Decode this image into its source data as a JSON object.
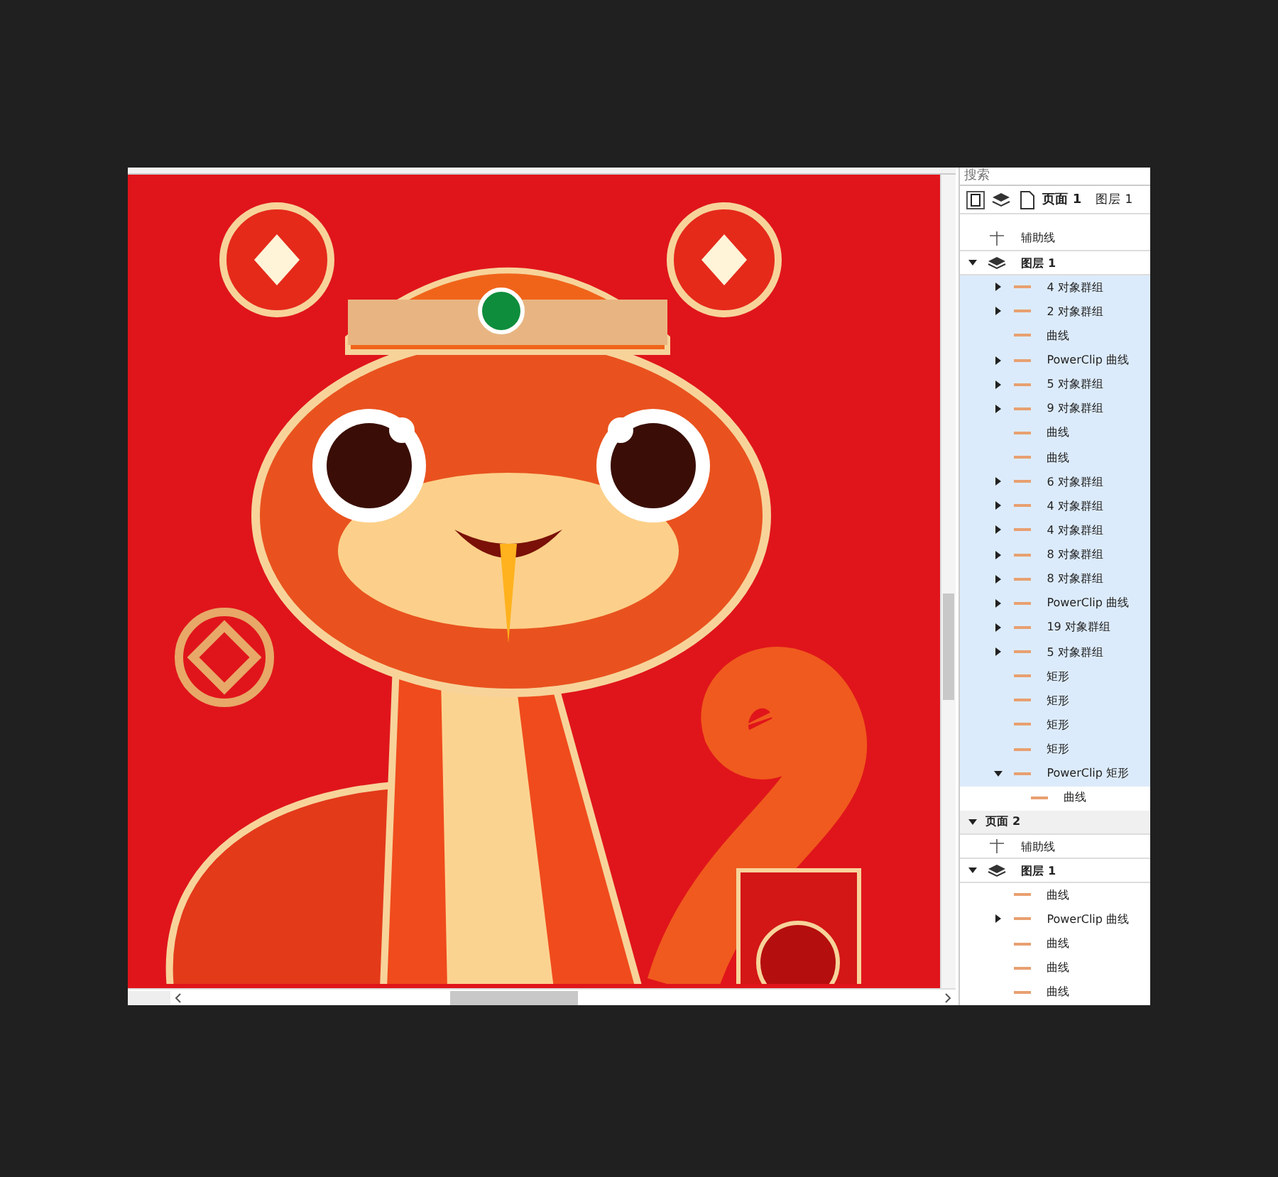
{
  "objects_panel": {
    "search": {
      "placeholder": "搜索"
    },
    "header": {
      "page": "页面 1",
      "layer": "图层 1"
    },
    "tree": [
      {
        "kind": "guides",
        "label": "辅助线"
      },
      {
        "kind": "layer",
        "label": "图层 1",
        "expanded": true,
        "children": [
          {
            "kind": "object",
            "label": "4 对象群组",
            "expanded": false,
            "selected": true
          },
          {
            "kind": "object",
            "label": "2 对象群组",
            "expanded": false,
            "selected": true
          },
          {
            "kind": "object",
            "label": "曲线",
            "selected": true
          },
          {
            "kind": "object",
            "label": "PowerClip 曲线",
            "expanded": false,
            "selected": true
          },
          {
            "kind": "object",
            "label": "5 对象群组",
            "expanded": false,
            "selected": true
          },
          {
            "kind": "object",
            "label": "9 对象群组",
            "expanded": false,
            "selected": true
          },
          {
            "kind": "object",
            "label": "曲线",
            "selected": true
          },
          {
            "kind": "object",
            "label": "曲线",
            "selected": true
          },
          {
            "kind": "object",
            "label": "6 对象群组",
            "expanded": false,
            "selected": true
          },
          {
            "kind": "object",
            "label": "4 对象群组",
            "expanded": false,
            "selected": true
          },
          {
            "kind": "object",
            "label": "4 对象群组",
            "expanded": false,
            "selected": true
          },
          {
            "kind": "object",
            "label": "8 对象群组",
            "expanded": false,
            "selected": true
          },
          {
            "kind": "object",
            "label": "8 对象群组",
            "expanded": false,
            "selected": true
          },
          {
            "kind": "object",
            "label": "PowerClip 曲线",
            "expanded": false,
            "selected": true
          },
          {
            "kind": "object",
            "label": "19 对象群组",
            "expanded": false,
            "selected": true
          },
          {
            "kind": "object",
            "label": "5 对象群组",
            "expanded": false,
            "selected": true
          },
          {
            "kind": "object",
            "label": "矩形",
            "selected": true
          },
          {
            "kind": "object",
            "label": "矩形",
            "selected": true
          },
          {
            "kind": "object",
            "label": "矩形",
            "selected": true
          },
          {
            "kind": "object",
            "label": "矩形",
            "selected": true
          },
          {
            "kind": "object",
            "label": "PowerClip 矩形",
            "expanded": true,
            "selected": true,
            "children": [
              {
                "kind": "object",
                "label": "曲线",
                "selected": false
              }
            ]
          }
        ]
      },
      {
        "kind": "page",
        "label": "页面 2",
        "expanded": true,
        "children": [
          {
            "kind": "guides",
            "label": "辅助线"
          },
          {
            "kind": "layer",
            "label": "图层 1",
            "expanded": true,
            "children": [
              {
                "kind": "object",
                "label": "曲线",
                "selected": false
              },
              {
                "kind": "object",
                "label": "PowerClip 曲线",
                "expanded": false,
                "selected": false
              },
              {
                "kind": "object",
                "label": "曲线",
                "selected": false
              },
              {
                "kind": "object",
                "label": "曲线",
                "selected": false
              },
              {
                "kind": "object",
                "label": "曲线",
                "selected": false
              }
            ]
          }
        ]
      }
    ]
  }
}
